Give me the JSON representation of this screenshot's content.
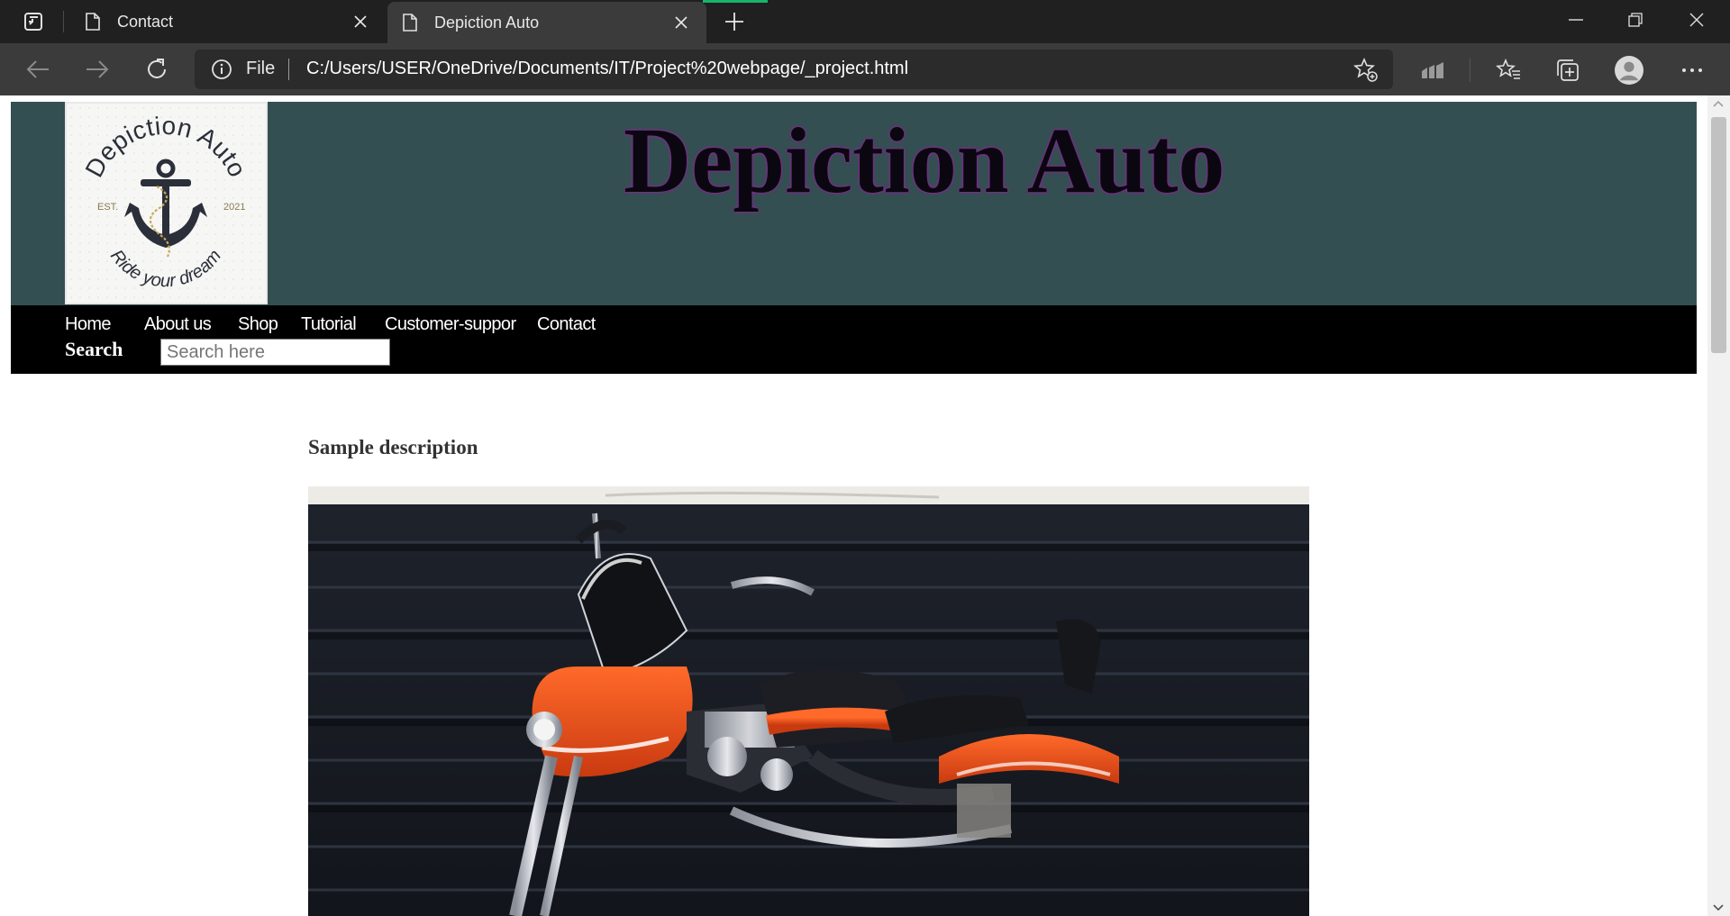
{
  "browser": {
    "tabs": [
      {
        "label": "Contact",
        "active": false
      },
      {
        "label": "Depiction Auto",
        "active": true
      }
    ],
    "address": {
      "scheme_label": "File",
      "url": "C:/Users/USER/OneDrive/Documents/IT/Project%20webpage/_project.html"
    },
    "icons": [
      "tab-actions-icon",
      "page-icon",
      "close-icon",
      "plus-icon",
      "minimize-icon",
      "restore-icon",
      "close-window-icon",
      "back-arrow-icon",
      "forward-arrow-icon",
      "refresh-icon",
      "info-icon",
      "favorite-add-icon",
      "performance-icon",
      "favorites-icon",
      "collections-icon",
      "profile-avatar-icon",
      "more-menu-icon"
    ],
    "colors": {
      "titlebar": "#202020",
      "toolbar": "#3b3b3b",
      "accent": "#18b36b"
    }
  },
  "site": {
    "title": "Depiction Auto",
    "logo": {
      "text_top": "Depiction Auto",
      "text_left": "EST.",
      "text_right": "2021",
      "text_bottom": "Ride your dream"
    },
    "nav": [
      "Home",
      "About us",
      "Shop",
      "Tutorial",
      "Customer-suppor",
      "Contact"
    ],
    "search": {
      "label": "Search",
      "placeholder": "Search here"
    },
    "colors": {
      "header_bg": "#344f51",
      "nav_bg": "#000000",
      "title_glow": "#9b1fa8"
    }
  },
  "main": {
    "description": "Sample description"
  }
}
